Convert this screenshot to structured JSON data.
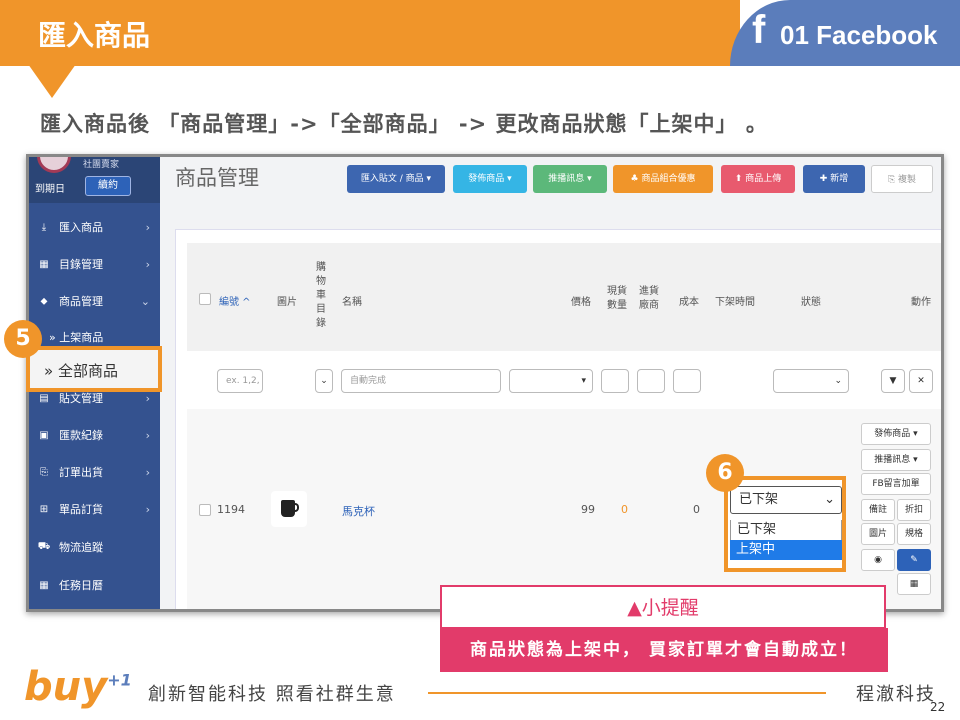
{
  "header": {
    "title": "匯入商品",
    "fb_icon": "f",
    "section": "01 Facebook"
  },
  "instruction": "匯入商品後 「商品管理」->「全部商品」 -> 更改商品狀態「上架中」 。",
  "sidebar": {
    "shop_label": "社團賣家",
    "expire_label": "到期日",
    "renew_label": "續約",
    "items": [
      {
        "icon": "download-icon",
        "glyph": "⤓",
        "label": "匯入商品",
        "chev": "›"
      },
      {
        "icon": "catalog-icon",
        "glyph": "▦",
        "label": "目錄管理",
        "chev": "›"
      },
      {
        "icon": "tag-icon",
        "glyph": "⬥",
        "label": "商品管理",
        "chev": "⌄"
      },
      {
        "icon": "post-icon",
        "glyph": "▤",
        "label": "貼文管理",
        "chev": "›"
      },
      {
        "icon": "money-icon",
        "glyph": "▣",
        "label": "匯款紀錄",
        "chev": "›"
      },
      {
        "icon": "order-icon",
        "glyph": "⎘",
        "label": "訂單出貨",
        "chev": "›"
      },
      {
        "icon": "gift-icon",
        "glyph": "⊞",
        "label": "單品訂貨",
        "chev": "›"
      },
      {
        "icon": "truck-icon",
        "glyph": "⛟",
        "label": "物流追蹤",
        "chev": ""
      },
      {
        "icon": "calendar-icon",
        "glyph": "▦",
        "label": "任務日曆",
        "chev": ""
      }
    ],
    "sub_on_shelf": "» 上架商品",
    "sub_all": "»  全部商品"
  },
  "main": {
    "title": "商品管理",
    "toolbar": [
      {
        "label": "匯入貼文 / 商品 ▾",
        "color": "#3d66b0"
      },
      {
        "label": "發佈商品 ▾",
        "color": "#35b5e5"
      },
      {
        "label": "推播訊息 ▾",
        "color": "#5cb87a"
      },
      {
        "label": "♣ 商品組合優惠",
        "color": "#f0952a"
      },
      {
        "label": "⬆ 商品上傳",
        "color": "#e85a6e"
      },
      {
        "label": "✚ 新增",
        "color": "#3d66b0"
      },
      {
        "label": "⎘ 複製",
        "color": "#ffffff"
      }
    ],
    "columns": {
      "id": "編號 ^",
      "image": "圖片",
      "cart": "購\n物\n車\n目\n錄",
      "name": "名稱",
      "price": "價格",
      "stock": "現貨\n數量",
      "supplier": "進貨\n廠商",
      "cost": "成本",
      "off_time": "下架時間",
      "status": "狀態",
      "action": "動作"
    },
    "filters": {
      "id_placeholder": "ex. 1,2,",
      "name_placeholder": "自動完成"
    },
    "row": {
      "id": "1194",
      "name": "馬克杯",
      "price": "99",
      "stock": "0",
      "cost": "0"
    },
    "actions": {
      "publish": "發佈商品 ▾",
      "push": "推播訊息 ▾",
      "fb_comment": "FB留言加單",
      "note": "備註",
      "discount": "折扣",
      "image": "圖片",
      "spec": "規格"
    },
    "status_select": {
      "selected": "已下架",
      "options": [
        "已下架",
        "上架中"
      ],
      "highlighted": "上架中"
    }
  },
  "callouts": {
    "step5": "5",
    "step6": "6"
  },
  "tip": {
    "title": "▲小提醒",
    "body": "商品狀態為上架中， 買家訂單才會自動成立！"
  },
  "footer": {
    "logo": "buy",
    "logo_sup": "+1",
    "slogan": "創新智能科技 照看社群生意",
    "company": "程澈科技",
    "page": "22"
  }
}
